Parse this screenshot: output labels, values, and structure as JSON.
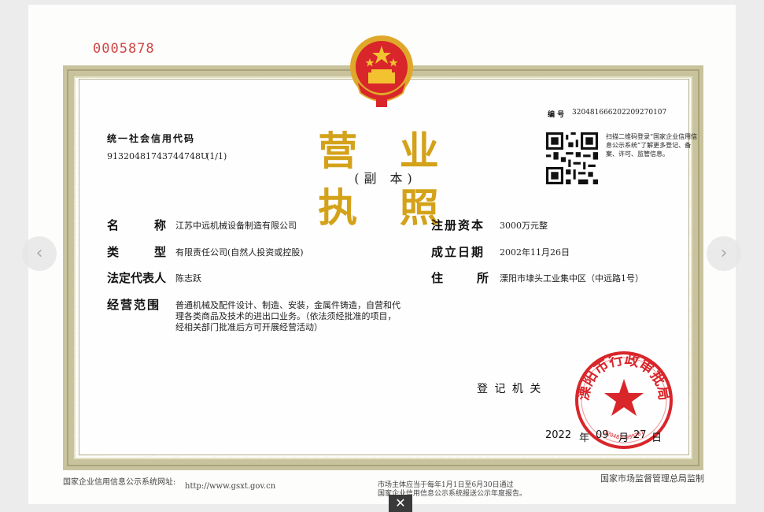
{
  "document": {
    "serial_number": "0005878",
    "title": "营 业 执 照",
    "subtitle": "(副 本)",
    "registration_number_label": "编 号",
    "registration_number": "320481666202209270107",
    "credit_code_label": "统一社会信用代码",
    "credit_code": "91320481743744748U",
    "copy_index": "(1/1)",
    "qr_note": "扫描二维码登录“国家企业信用信息公示系统”了解更多登记、备案、许可、监管信息。"
  },
  "fields": {
    "name_label_1": "名",
    "name_label_2": "称",
    "name_value": "江苏中远机械设备制造有限公司",
    "type_label_1": "类",
    "type_label_2": "型",
    "type_value": "有限责任公司(自然人投资或控股)",
    "legal_rep_label": "法定代表人",
    "legal_rep_value": "陈志跃",
    "scope_label": "经营范围",
    "scope_value_1": "普通机械及配件设计、制造、安装，金属件铸造，自营和代",
    "scope_value_2": "理各类商品及技术的进出口业务。（依法须经批准的项目，",
    "scope_value_3": "经相关部门批准后方可开展经营活动）",
    "capital_label": "注册资本",
    "capital_value": "3000万元整",
    "established_label": "成立日期",
    "established_value": "2002年11月26日",
    "address_label_1": "住",
    "address_label_2": "所",
    "address_value": "溧阳市埭头工业集中区（中远路1号）"
  },
  "authority": {
    "label": "登 记 机 关",
    "year": "2022",
    "year_unit": "年",
    "month": "09",
    "month_unit": "月",
    "day": "27",
    "day_unit": "日",
    "seal_text": "溧阳市行政审批局",
    "seal_number": "3204810999787"
  },
  "footer": {
    "website_label": "国家企业信用信息公示系统网址:",
    "website": "http://www.gsxt.gov.cn",
    "notice_1": "市场主体应当于每年1月1日至6月30日通过",
    "notice_2": "国家企业信用信息公示系统报送公示年度报告。",
    "issuer": "国家市场监督管理总局监制"
  },
  "viewer": {
    "prev_icon": "‹",
    "next_icon": "›",
    "close_icon": "✕"
  },
  "colors": {
    "title_gold": "#d4a21a",
    "seal_red": "#d8262b",
    "serial_red": "#cf4545",
    "frame": "#c8c39c"
  }
}
